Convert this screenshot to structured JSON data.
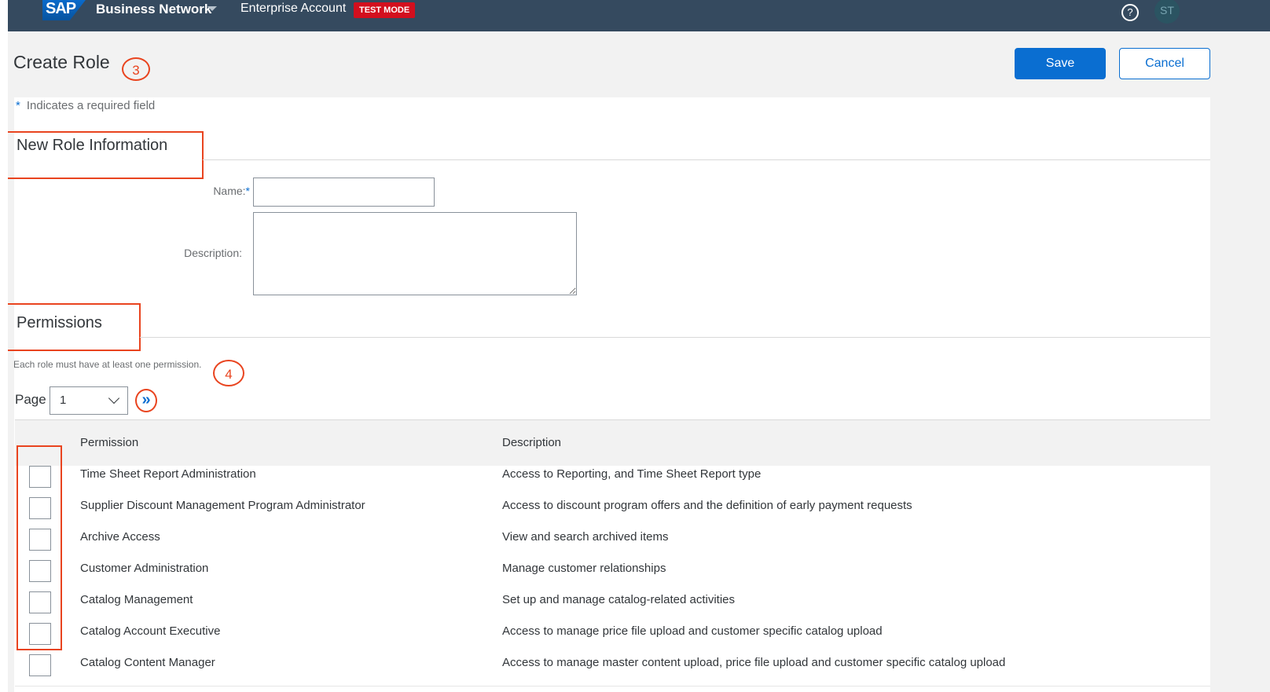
{
  "shell": {
    "logo_text": "SAP",
    "product": "Business Network",
    "account": "Enterprise Account",
    "test_badge": "TEST MODE",
    "help_glyph": "?",
    "avatar_initials": "ST"
  },
  "header": {
    "title": "Create Role",
    "marker_title": "3",
    "save_label": "Save",
    "cancel_label": "Cancel"
  },
  "form": {
    "required_star": "*",
    "required_text": "Indicates a required field",
    "section_info": "New Role Information",
    "name_label": "Name:",
    "description_label": "Description:",
    "name_value": "",
    "description_value": ""
  },
  "permissions": {
    "section_title": "Permissions",
    "note": "Each role must have at least one permission.",
    "marker_note": "4",
    "page_label": "Page",
    "page_value": "1",
    "columns": {
      "permission": "Permission",
      "description": "Description"
    },
    "rows": [
      {
        "permission": "Time Sheet Report Administration",
        "description": "Access to Reporting, and Time Sheet Report type",
        "checked": false
      },
      {
        "permission": "Supplier Discount Management Program Administrator",
        "description": "Access to discount program offers and the definition of early payment requests",
        "checked": false
      },
      {
        "permission": "Archive Access",
        "description": "View and search archived items",
        "checked": false
      },
      {
        "permission": "Customer Administration",
        "description": "Manage customer relationships",
        "checked": false
      },
      {
        "permission": "Catalog Management",
        "description": "Set up and manage catalog-related activities",
        "checked": false
      },
      {
        "permission": "Catalog Account Executive",
        "description": "Access to manage price file upload and customer specific catalog upload",
        "checked": false
      },
      {
        "permission": "Catalog Content Manager",
        "description": "Access to manage master content upload, price file upload and customer specific catalog upload",
        "checked": false
      }
    ]
  },
  "colors": {
    "shell_bg": "#354a5f",
    "accent": "#0a6ed1",
    "annotation": "#e9441f",
    "test_badge": "#d30f1e"
  },
  "icons": {
    "help": "help-circle-icon",
    "next_page": "double-chevron-right-icon",
    "dropdown": "chevron-down-icon"
  }
}
